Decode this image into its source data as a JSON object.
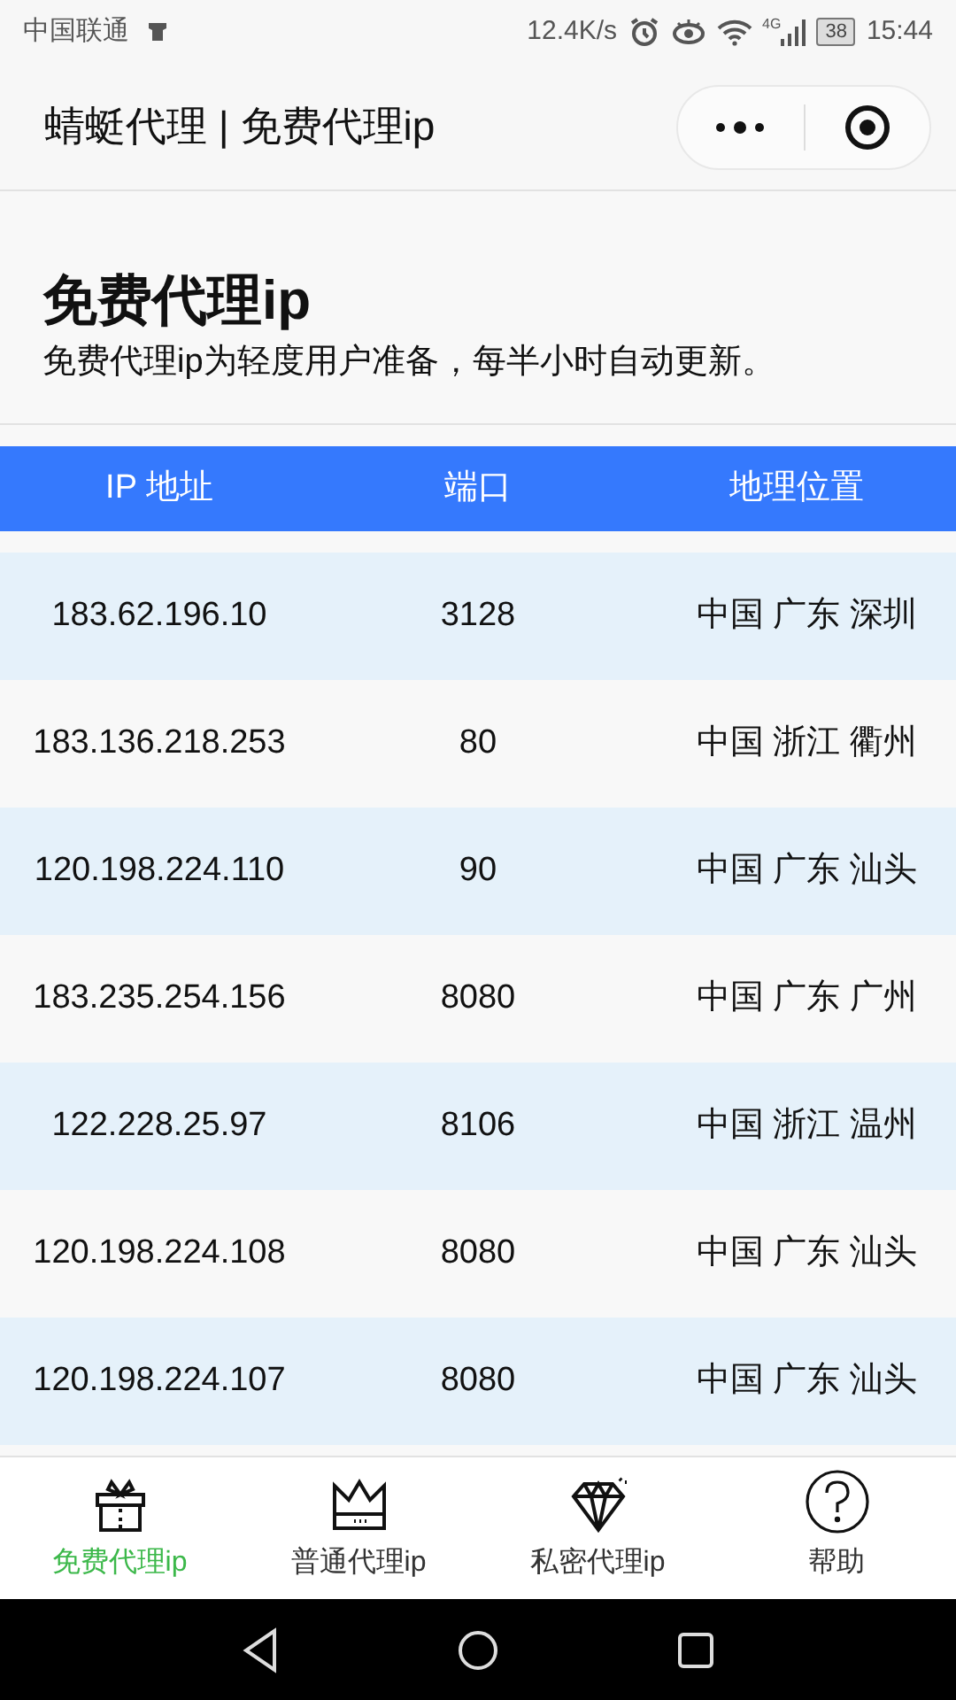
{
  "status_bar": {
    "carrier": "中国联通",
    "speed": "12.4K/s",
    "network": "4G",
    "battery": "38",
    "time": "15:44"
  },
  "header": {
    "title": "蜻蜓代理 | 免费代理ip"
  },
  "intro": {
    "heading": "免费代理ip",
    "description": "免费代理ip为轻度用户准备，每半小时自动更新。"
  },
  "table": {
    "columns": [
      "IP 地址",
      "端口",
      "地理位置"
    ],
    "rows": [
      {
        "ip": "183.62.196.10",
        "port": "3128",
        "location": "中国 广东 深圳"
      },
      {
        "ip": "183.136.218.253",
        "port": "80",
        "location": "中国 浙江 衢州"
      },
      {
        "ip": "120.198.224.110",
        "port": "90",
        "location": "中国 广东 汕头"
      },
      {
        "ip": "183.235.254.156",
        "port": "8080",
        "location": "中国 广东 广州"
      },
      {
        "ip": "122.228.25.97",
        "port": "8106",
        "location": "中国 浙江 温州"
      },
      {
        "ip": "120.198.224.108",
        "port": "8080",
        "location": "中国 广东 汕头"
      },
      {
        "ip": "120.198.224.107",
        "port": "8080",
        "location": "中国 广东 汕头"
      }
    ]
  },
  "tab_bar": [
    {
      "kind": "gift",
      "label": "免费代理ip",
      "selected": true
    },
    {
      "kind": "crown",
      "label": "普通代理ip",
      "selected": false
    },
    {
      "kind": "diamond",
      "label": "私密代理ip",
      "selected": false
    },
    {
      "kind": "help",
      "label": "帮助",
      "selected": false
    }
  ]
}
